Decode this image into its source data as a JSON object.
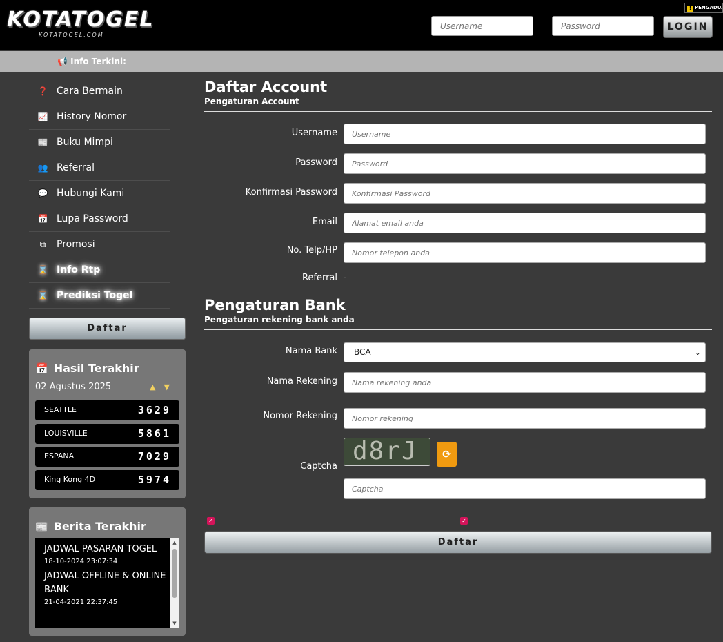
{
  "header": {
    "logo_text": "KOTATOGEL",
    "logo_sub": "KOTATOGEL.COM",
    "username_placeholder": "Username",
    "password_placeholder": "Password",
    "login_label": "LOGIN",
    "pengaduan_label": "PENGADUAN"
  },
  "infobar": {
    "label": "Info Terkini:"
  },
  "sidebar": {
    "menu": [
      {
        "icon": "question-circle-icon",
        "glyph": "❓",
        "label": "Cara Bermain"
      },
      {
        "icon": "line-chart-icon",
        "glyph": "📈",
        "label": "History Nomor"
      },
      {
        "icon": "newspaper-icon",
        "glyph": "📰",
        "label": "Buku Mimpi"
      },
      {
        "icon": "users-icon",
        "glyph": "👥",
        "label": "Referral"
      },
      {
        "icon": "chat-icon",
        "glyph": "💬",
        "label": "Hubungi Kami"
      },
      {
        "icon": "calendar-icon",
        "glyph": "📅",
        "label": "Lupa Password"
      },
      {
        "icon": "clone-icon",
        "glyph": "⧉",
        "label": "Promosi"
      },
      {
        "icon": "hourglass-icon",
        "glyph": "⌛",
        "label": "Info Rtp"
      },
      {
        "icon": "hourglass-icon",
        "glyph": "⌛",
        "label": "Prediksi Togel"
      }
    ],
    "daftar_label": "Daftar"
  },
  "hasil": {
    "title": "Hasil Terakhir",
    "date": "02 Agustus 2025",
    "results": [
      {
        "name": "SEATTLE",
        "number": "3629"
      },
      {
        "name": "LOUISVILLE",
        "number": "5861"
      },
      {
        "name": "ESPANA",
        "number": "7029"
      },
      {
        "name": "King Kong 4D",
        "number": "5974"
      }
    ]
  },
  "berita": {
    "title": "Berita Terakhir",
    "items": [
      {
        "title": "JADWAL PASARAN TOGEL",
        "date": "18-10-2024 23:07:34"
      },
      {
        "title": "JADWAL OFFLINE & ONLINE BANK",
        "date": "21-04-2021 22:37:45"
      }
    ]
  },
  "account": {
    "title": "Daftar Account",
    "subtitle": "Pengaturan Account",
    "fields": {
      "username": {
        "label": "Username",
        "placeholder": "Username"
      },
      "password": {
        "label": "Password",
        "placeholder": "Password"
      },
      "confirm": {
        "label": "Konfirmasi Password",
        "placeholder": "Konfirmasi Password"
      },
      "email": {
        "label": "Email",
        "placeholder": "Alamat email anda"
      },
      "phone": {
        "label": "No. Telp/HP",
        "placeholder": "Nomor telepon anda"
      },
      "referral": {
        "label": "Referral",
        "value": "-"
      }
    }
  },
  "bank": {
    "title": "Pengaturan Bank",
    "subtitle": "Pengaturan rekening bank anda",
    "fields": {
      "bank_name": {
        "label": "Nama Bank",
        "selected": "BCA"
      },
      "account_name": {
        "label": "Nama Rekening",
        "placeholder": "Nama rekening anda"
      },
      "account_number": {
        "label": "Nomor Rekening",
        "placeholder": "Nomor rekening"
      },
      "captcha": {
        "label": "Captcha",
        "image_text": "d8rJ",
        "placeholder": "Captcha"
      }
    }
  },
  "submit_label": "Daftar",
  "colors": {
    "accent_orange": "#f09a10",
    "checkbox": "#d4145a",
    "background": "#3a3a3a"
  }
}
